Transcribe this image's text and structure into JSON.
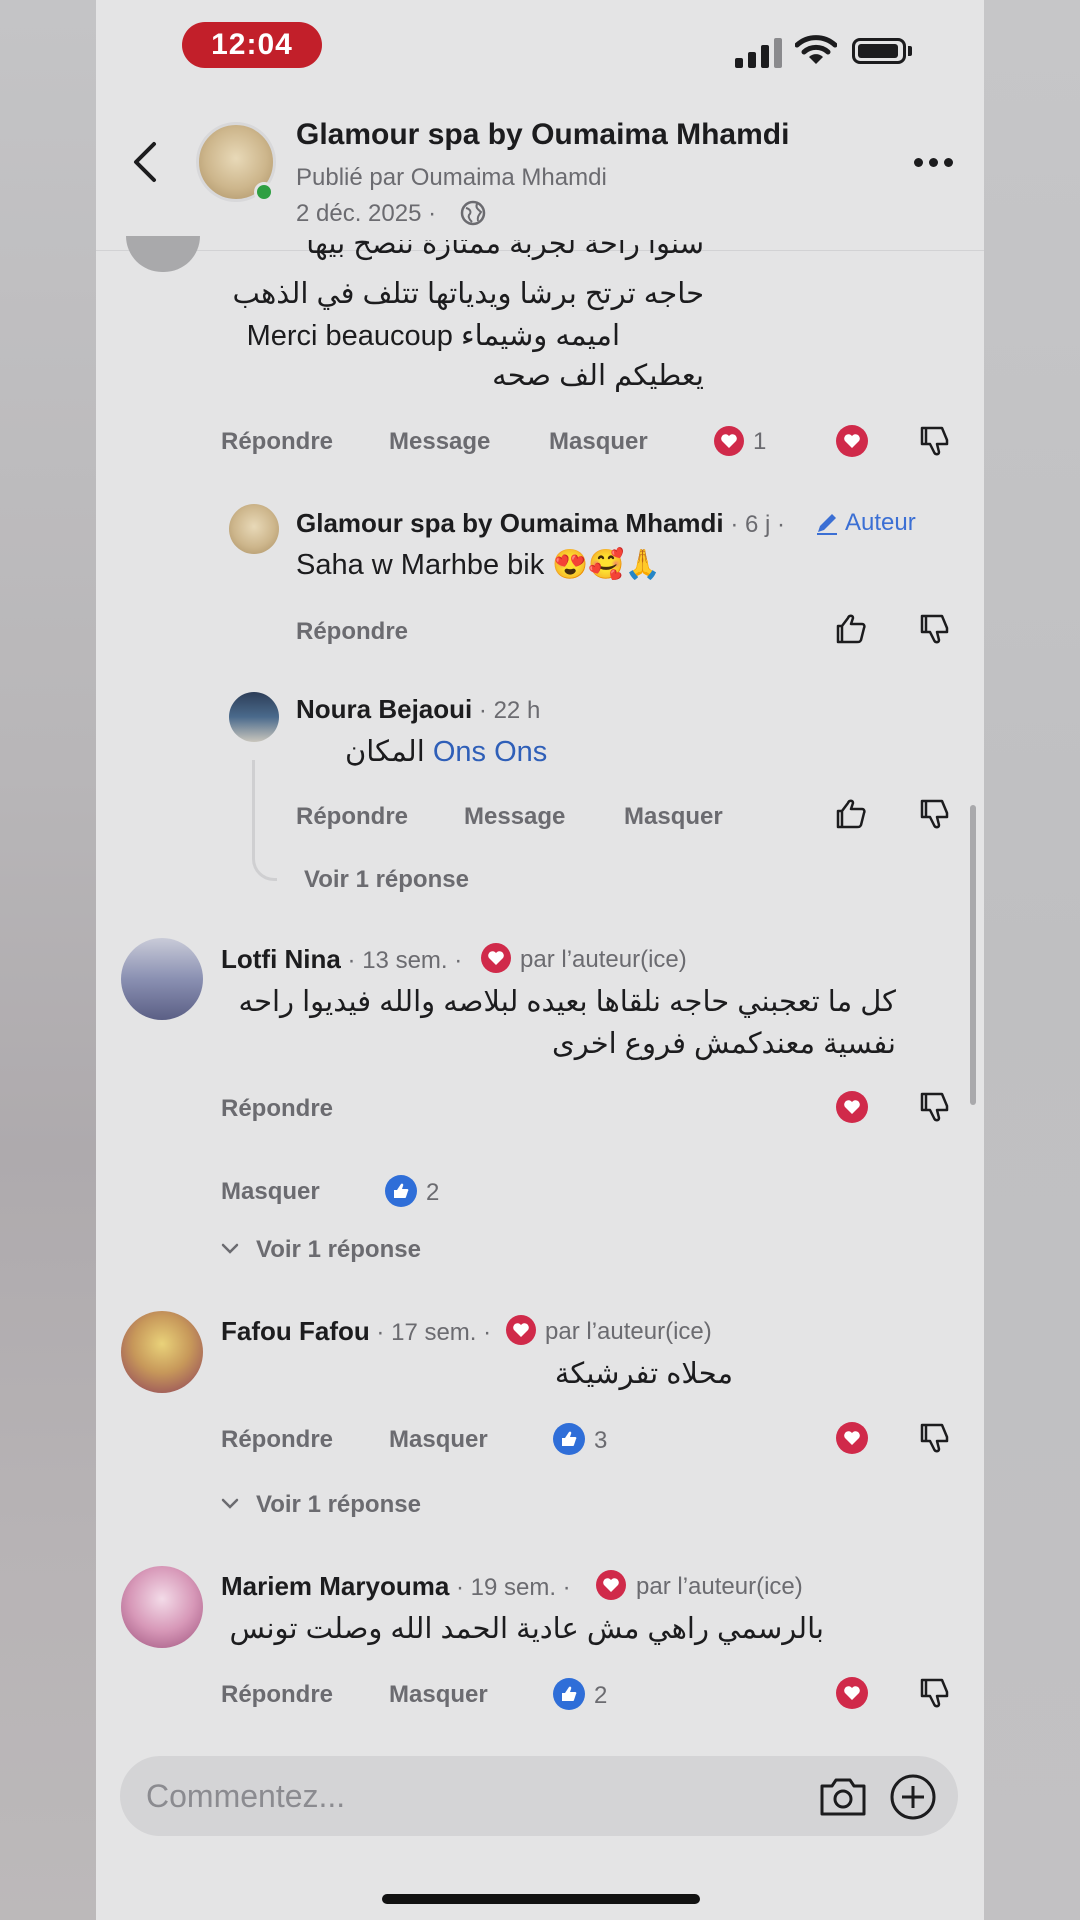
{
  "status_bar": {
    "time": "12:04"
  },
  "header": {
    "page_name": "Glamour spa by Oumaima Mhamdi",
    "published_by": "Publié par Oumaima Mhamdi",
    "date": "2 déc. 2025 ·"
  },
  "comments": [
    {
      "text_lines": [
        "سنوا راحة لجربة ممتازة ننصح بيها",
        "حاجه ترتح برشا ويدياتها تتلف في الذهب",
        "اميمه وشيماء Merci beaucoup",
        "يعطيكم الف صحه"
      ],
      "actions": {
        "reply": "Répondre",
        "message": "Message",
        "hide": "Masquer"
      },
      "reaction_count": "1"
    },
    {
      "author": "Glamour spa by Oumaima Mhamdi",
      "meta": " · 6 j · ",
      "author_tag": "Auteur",
      "text": "Saha w Marhbe bik 😍🥰🙏",
      "actions": {
        "reply": "Répondre"
      }
    },
    {
      "author": "Noura Bejaoui",
      "meta": " · 22 h",
      "text_prefix": "المكان ",
      "mention": "Ons Ons",
      "actions": {
        "reply": "Répondre",
        "message": "Message",
        "hide": "Masquer"
      },
      "view_replies": "Voir 1 réponse"
    },
    {
      "author": "Lotfi Nina",
      "meta": " · 13 sem. · ",
      "liked_by_author": "par l’auteur(ice)",
      "text_lines": [
        "كل ما تعجبني حاجه نلقاها بعيده لبلاصه والله فيديوا راحه",
        "نفسية معندكمش فروع اخرى"
      ],
      "actions": {
        "reply": "Répondre",
        "hide": "Masquer"
      },
      "like_count": "2",
      "view_replies": "Voir 1 réponse"
    },
    {
      "author": "Fafou Fafou",
      "meta": " · 17 sem. · ",
      "liked_by_author": "par l’auteur(ice)",
      "text": "محلاه تفرشيكة",
      "actions": {
        "reply": "Répondre",
        "hide": "Masquer"
      },
      "like_count": "3",
      "view_replies": "Voir 1 réponse"
    },
    {
      "author": "Mariem Maryouma",
      "meta": " · 19 sem. · ",
      "liked_by_author": "par l’auteur(ice)",
      "text": "بالرسمي راهي مش عادية الحمد الله وصلت تونس",
      "actions": {
        "reply": "Répondre",
        "hide": "Masquer"
      },
      "like_count": "2"
    }
  ],
  "composer": {
    "placeholder": "Commentez..."
  },
  "colors": {
    "heart": "#d02a4a",
    "like": "#2f6ed8",
    "time_pill": "#c21f2a",
    "online": "#2e9f42"
  }
}
